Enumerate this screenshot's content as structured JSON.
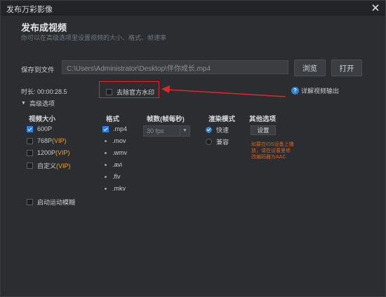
{
  "window": {
    "title": "发布万彩影像"
  },
  "header": {
    "heading": "发布成视频",
    "subtitle": "你可以在高级选项里设置视频的大小、格式、帧速率"
  },
  "save": {
    "label": "保存到文件",
    "path": "C:\\Users\\Administrator\\Desktop\\伴你成长.mp4",
    "browse_label": "浏览",
    "open_label": "打开"
  },
  "info": {
    "duration": "时长: 00:00:28.5",
    "watermark_label": "去除官方水印",
    "watermark_checked": false,
    "help_label": "详解视频输出",
    "help_icon": "?"
  },
  "advanced": {
    "label": "高级选项"
  },
  "size": {
    "header": "视频大小",
    "options": [
      {
        "label": "600P",
        "vip": "",
        "checked": true
      },
      {
        "label": "768P",
        "vip": "(VIP)",
        "checked": false
      },
      {
        "label": "1200P",
        "vip": "(VIP)",
        "checked": false
      },
      {
        "label": "自定义",
        "vip": "(VIP)",
        "checked": false
      }
    ]
  },
  "format": {
    "header": "格式",
    "options": [
      {
        "label": ".mp4",
        "checked": true
      },
      {
        "label": ".mov",
        "checked": false
      },
      {
        "label": ".wmv",
        "checked": false
      },
      {
        "label": ".avi",
        "checked": false
      },
      {
        "label": ".flv",
        "checked": false
      },
      {
        "label": ".mkv",
        "checked": false
      }
    ]
  },
  "fps": {
    "header": "帧数(帧每秒)",
    "value": "30 fps"
  },
  "render": {
    "header": "渲染模式",
    "options": [
      {
        "label": "快速",
        "checked": true
      },
      {
        "label": "兼容",
        "checked": false
      }
    ]
  },
  "other": {
    "header": "其他选项",
    "settings_label": "设置",
    "note": "如要在iOS设备上播放，请在设置里修改编码器为AAC"
  },
  "motion_blur": {
    "label": "启动运动模糊",
    "checked": false
  },
  "colors": {
    "accent": "#2f80d6",
    "highlight": "#e0262d",
    "vip": "#f0a030",
    "note": "#d9621e"
  }
}
